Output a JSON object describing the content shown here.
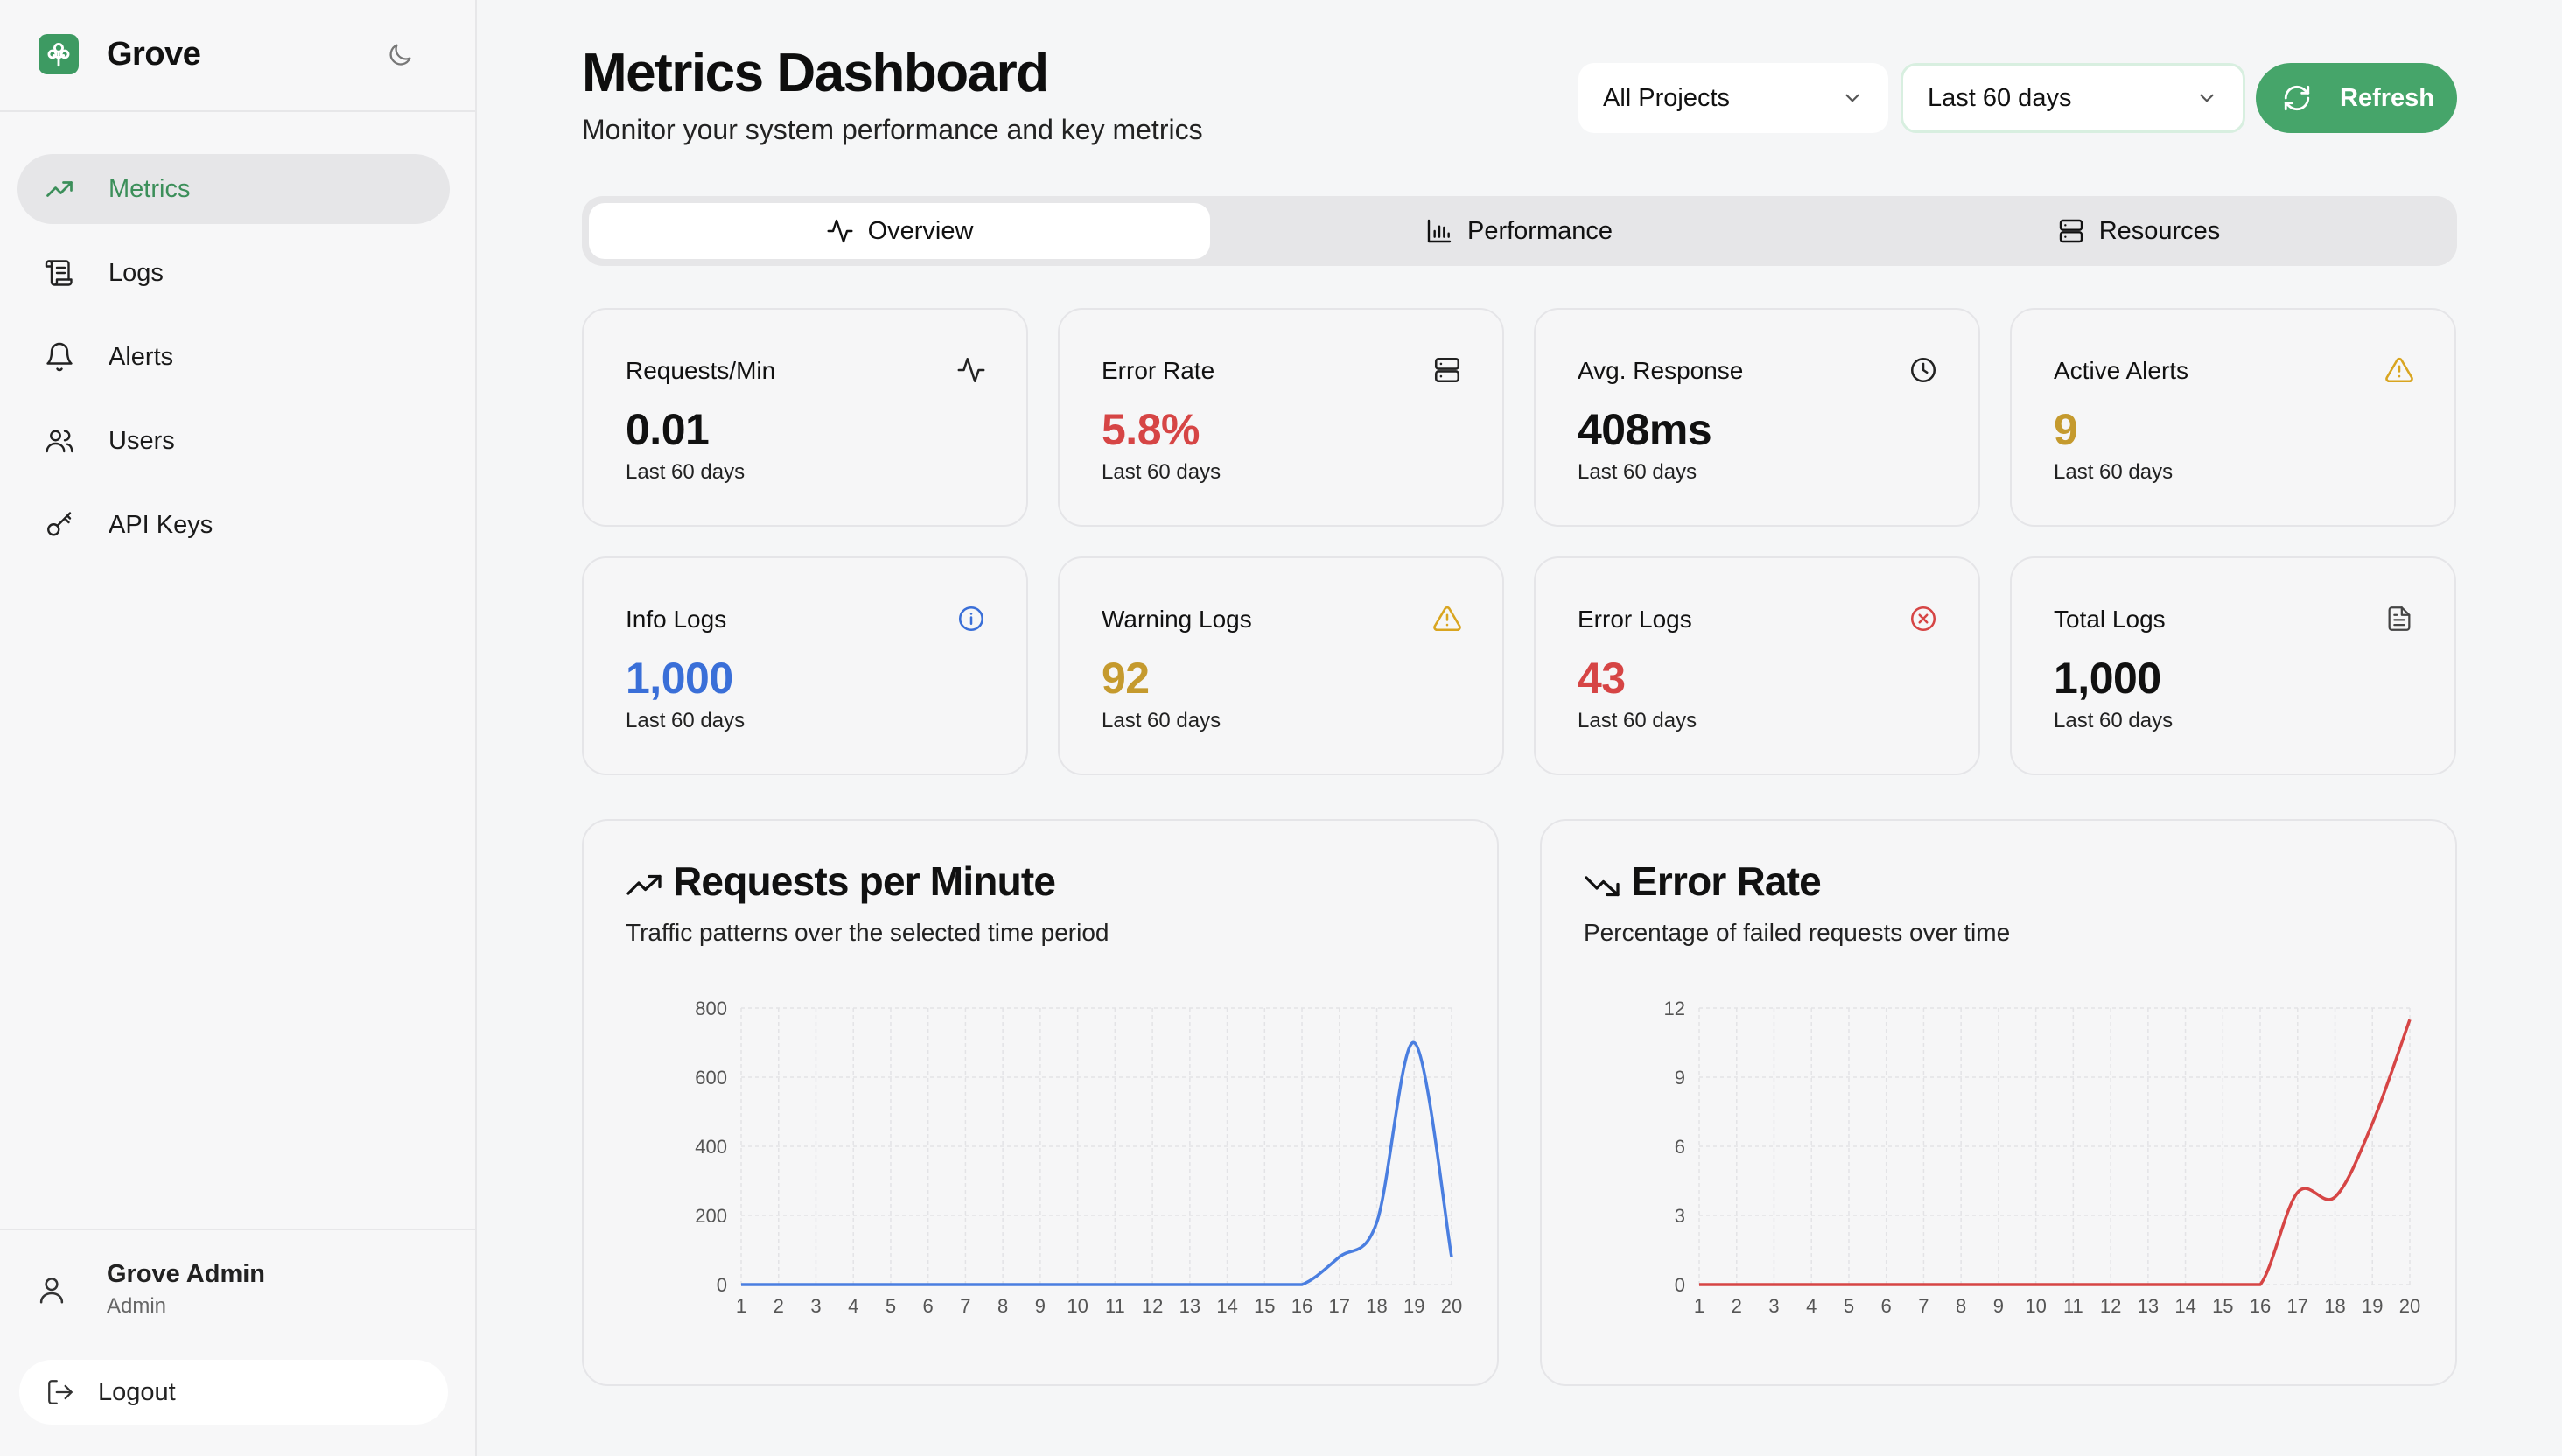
{
  "app": {
    "name": "Grove"
  },
  "colors": {
    "accent": "#46a56a",
    "accent_text": "#3c8f5a",
    "error": "#d64545",
    "warning": "#c59a2e",
    "info": "#3a6fd8",
    "chart_blue": "#4a7ee0",
    "chart_red": "#d64545"
  },
  "sidebar": {
    "items": [
      {
        "label": "Metrics",
        "icon": "trending-up-icon",
        "active": true
      },
      {
        "label": "Logs",
        "icon": "scroll-icon",
        "active": false
      },
      {
        "label": "Alerts",
        "icon": "bell-icon",
        "active": false
      },
      {
        "label": "Users",
        "icon": "users-icon",
        "active": false
      },
      {
        "label": "API Keys",
        "icon": "key-icon",
        "active": false
      }
    ],
    "user": {
      "name": "Grove Admin",
      "role": "Admin"
    },
    "logout_label": "Logout"
  },
  "header": {
    "title": "Metrics Dashboard",
    "subtitle": "Monitor your system performance and key metrics",
    "project_select": "All Projects",
    "range_select": "Last 60 days",
    "refresh_label": "Refresh"
  },
  "tabs": [
    {
      "label": "Overview",
      "icon": "activity-icon",
      "active": true
    },
    {
      "label": "Performance",
      "icon": "bar-chart-icon",
      "active": false
    },
    {
      "label": "Resources",
      "icon": "server-icon",
      "active": false
    }
  ],
  "stats": [
    {
      "label": "Requests/Min",
      "value": "0.01",
      "sub": "Last 60 days",
      "icon": "activity-icon",
      "color": "#111111"
    },
    {
      "label": "Error Rate",
      "value": "5.8%",
      "sub": "Last 60 days",
      "icon": "server-icon",
      "color": "#d64545"
    },
    {
      "label": "Avg. Response",
      "value": "408ms",
      "sub": "Last 60 days",
      "icon": "clock-icon",
      "color": "#111111"
    },
    {
      "label": "Active Alerts",
      "value": "9",
      "sub": "Last 60 days",
      "icon": "warning-icon",
      "color": "#c59a2e"
    },
    {
      "label": "Info Logs",
      "value": "1,000",
      "sub": "Last 60 days",
      "icon": "info-icon",
      "color": "#3a6fd8"
    },
    {
      "label": "Warning Logs",
      "value": "92",
      "sub": "Last 60 days",
      "icon": "warning-icon",
      "color": "#c59a2e"
    },
    {
      "label": "Error Logs",
      "value": "43",
      "sub": "Last 60 days",
      "icon": "x-circle-icon",
      "color": "#d64545"
    },
    {
      "label": "Total Logs",
      "value": "1,000",
      "sub": "Last 60 days",
      "icon": "file-icon",
      "color": "#111111"
    }
  ],
  "charts": {
    "requests": {
      "title": "Requests per Minute",
      "subtitle": "Traffic patterns over the selected time period",
      "icon": "trending-up-icon"
    },
    "errors": {
      "title": "Error Rate",
      "subtitle": "Percentage of failed requests over time",
      "icon": "trending-down-icon"
    }
  },
  "chart_data": [
    {
      "type": "line",
      "title": "Requests per Minute",
      "x": [
        1,
        2,
        3,
        4,
        5,
        6,
        7,
        8,
        9,
        10,
        11,
        12,
        13,
        14,
        15,
        16,
        17,
        18,
        19,
        20
      ],
      "series": [
        {
          "values": [
            0,
            0,
            0,
            0,
            0,
            0,
            0,
            0,
            0,
            0,
            0,
            0,
            0,
            0,
            0,
            0,
            80,
            180,
            700,
            80
          ]
        }
      ],
      "xlabel": "",
      "ylabel": "",
      "yticks": [
        0,
        200,
        400,
        600,
        800
      ],
      "ylim": [
        0,
        800
      ],
      "grid": true,
      "color": "#4a7ee0"
    },
    {
      "type": "line",
      "title": "Error Rate",
      "x": [
        1,
        2,
        3,
        4,
        5,
        6,
        7,
        8,
        9,
        10,
        11,
        12,
        13,
        14,
        15,
        16,
        17,
        18,
        19,
        20
      ],
      "series": [
        {
          "values": [
            0,
            0,
            0,
            0,
            0,
            0,
            0,
            0,
            0,
            0,
            0,
            0,
            0,
            0,
            0,
            0,
            4,
            3.8,
            7,
            11.5
          ]
        }
      ],
      "xlabel": "",
      "ylabel": "",
      "yticks": [
        0,
        3,
        6,
        9,
        12
      ],
      "ylim": [
        0,
        12
      ],
      "grid": true,
      "color": "#d64545"
    }
  ]
}
